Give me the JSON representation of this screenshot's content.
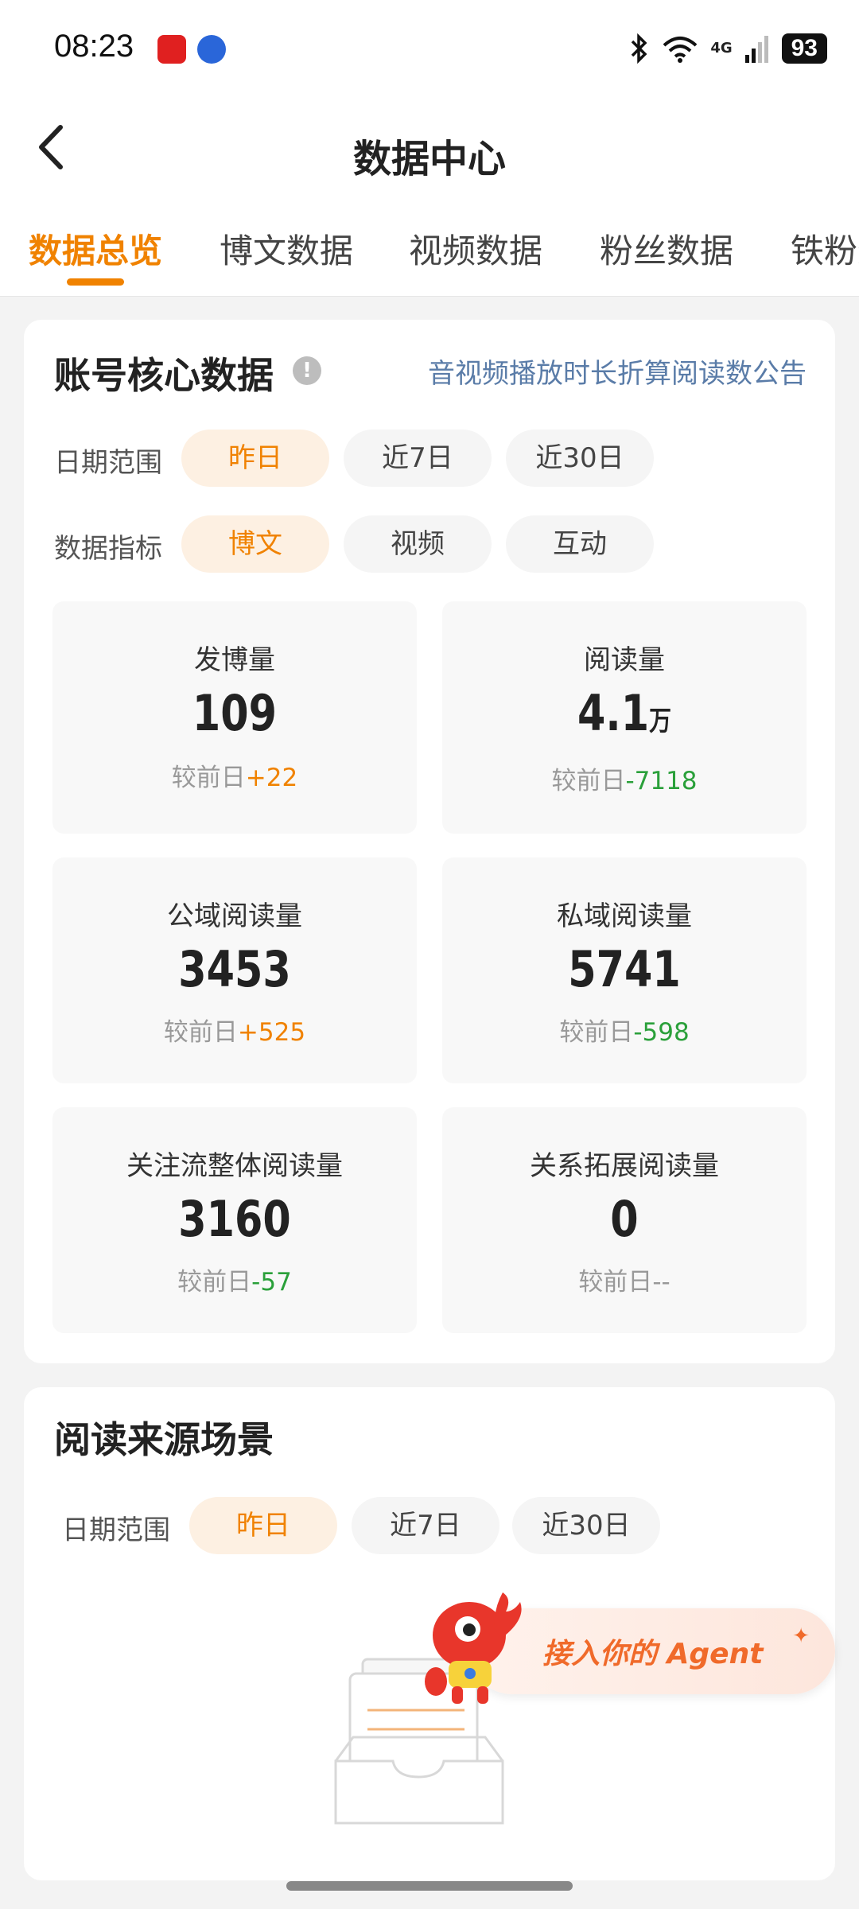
{
  "status_bar": {
    "time": "08:23",
    "network": "4G",
    "battery": "93"
  },
  "nav": {
    "title": "数据中心"
  },
  "tabs": [
    {
      "label": "博文数据"
    },
    {
      "label": "视频数据"
    },
    {
      "label": "粉丝数据"
    },
    {
      "label": "铁粉数"
    }
  ],
  "active_tab": "数据总览",
  "core": {
    "title": "账号核心数据",
    "info_glyph": "!",
    "notice_link": "音视频播放时长折算阅读数公告",
    "date_label": "日期范围",
    "date_options": [
      "昨日",
      "近7日",
      "近30日"
    ],
    "metric_label": "数据指标",
    "metric_options": [
      "博文",
      "视频",
      "互动"
    ],
    "compare_prefix": "较前日",
    "metrics": [
      {
        "label": "发博量",
        "value": "109",
        "unit": "",
        "delta": "+22"
      },
      {
        "label": "阅读量",
        "value": "4.1",
        "unit": "万",
        "delta": "-7118"
      },
      {
        "label": "公域阅读量",
        "value": "3453",
        "unit": "",
        "delta": "+525"
      },
      {
        "label": "私域阅读量",
        "value": "5741",
        "unit": "",
        "delta": "-598"
      },
      {
        "label": "关注流整体阅读量",
        "value": "3160",
        "unit": "",
        "delta": "-57"
      },
      {
        "label": "关系拓展阅读量",
        "value": "0",
        "unit": "",
        "delta": "--"
      }
    ]
  },
  "source": {
    "title": "阅读来源场景",
    "date_label": "日期范围",
    "date_options": [
      "昨日",
      "近7日",
      "近30日"
    ]
  },
  "agent_banner": {
    "label": "接入你的 Agent"
  },
  "colors": {
    "accent": "#f08200",
    "increase": "#f08200",
    "decrease": "#2aa03a",
    "link": "#5a7ca8"
  }
}
